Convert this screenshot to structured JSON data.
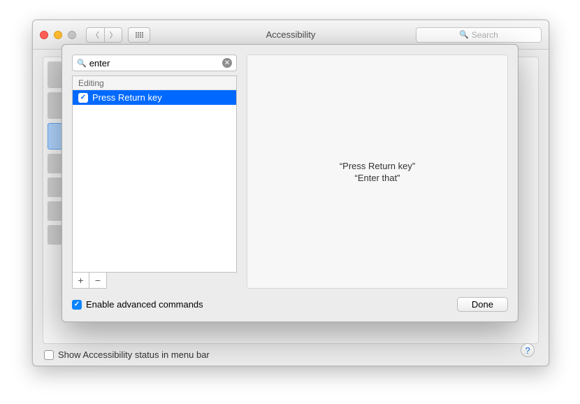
{
  "window": {
    "title": "Accessibility",
    "search_placeholder": "Search"
  },
  "sheet": {
    "search_value": "enter",
    "list_header": "Editing",
    "items": [
      {
        "label": "Press Return key",
        "checked": true,
        "selected": true
      }
    ],
    "detail_lines": [
      "“Press Return key”",
      "“Enter that”"
    ],
    "add_label": "+",
    "remove_label": "−",
    "enable_advanced_label": "Enable advanced commands",
    "enable_advanced_checked": true,
    "done_label": "Done"
  },
  "footer": {
    "show_status_label": "Show Accessibility status in menu bar",
    "show_status_checked": false,
    "help_label": "?"
  }
}
